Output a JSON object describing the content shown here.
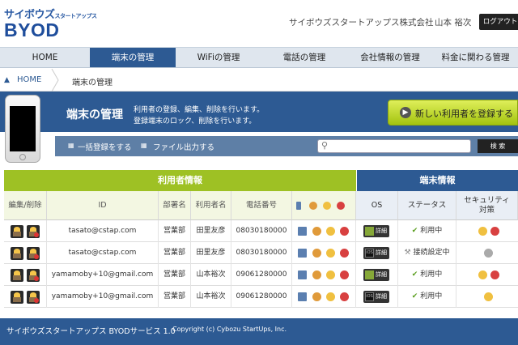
{
  "header": {
    "logo_top": "サイボウズ",
    "logo_top_small": "スタートアップス",
    "logo_main": "BYOD",
    "company": "サイボウズスタートアップス株式会社",
    "user": "山本 裕次",
    "logout_label": "ログアウト"
  },
  "nav": {
    "items": [
      {
        "label": "HOME",
        "active": false
      },
      {
        "label": "端末の管理",
        "active": true
      },
      {
        "label": "WiFiの管理",
        "active": false
      },
      {
        "label": "電話の管理",
        "active": false
      },
      {
        "label": "会社情報の管理",
        "active": false
      },
      {
        "label": "料金に関わる管理",
        "active": false
      }
    ]
  },
  "breadcrumb": {
    "home": "HOME",
    "current": "端末の管理"
  },
  "banner": {
    "title": "端末の管理",
    "desc_line1": "利用者の登録、編集、削除を行います。",
    "desc_line2": "登録端末のロック、削除を行います。",
    "register_label": "新しい利用者を登録する"
  },
  "toolbar": {
    "bulk_label": "一括登録をする",
    "export_label": "ファイル出力する",
    "search_placeholder": "",
    "search_button": "検 索"
  },
  "table": {
    "group_user": "利用者情報",
    "group_device": "端末情報",
    "columns": {
      "edit": "編集/削除",
      "id": "ID",
      "dept": "部署名",
      "user": "利用者名",
      "phone": "電話番号",
      "os": "OS",
      "status": "ステータス",
      "security_line1": "セキュリティ",
      "security_line2": "対策"
    },
    "os_detail": "詳細",
    "rows": [
      {
        "id": "tasato@cstap.com",
        "dept": "営業部",
        "user": "田里友彦",
        "phone": "08030180000",
        "os": "android",
        "status": "利用中",
        "status_icon": "check-icon"
      },
      {
        "id": "tasato@cstap.com",
        "dept": "営業部",
        "user": "田里友彦",
        "phone": "08030180000",
        "os": "ios",
        "status": "接続設定中",
        "status_icon": "wrench-icon"
      },
      {
        "id": "yamamoby+10@gmail.com",
        "dept": "営業部",
        "user": "山本裕次",
        "phone": "09061280000",
        "os": "android",
        "status": "利用中",
        "status_icon": "check-icon"
      },
      {
        "id": "yamamoby+10@gmail.com",
        "dept": "営業部",
        "user": "山本裕次",
        "phone": "09061280000",
        "os": "ios",
        "status": "利用中",
        "status_icon": "check-icon"
      }
    ]
  },
  "footer": {
    "name": "サイボウズスタートアップス BYODサービス 1.0",
    "copyright": "Copyright (c) Cybozu StartUps, Inc."
  }
}
